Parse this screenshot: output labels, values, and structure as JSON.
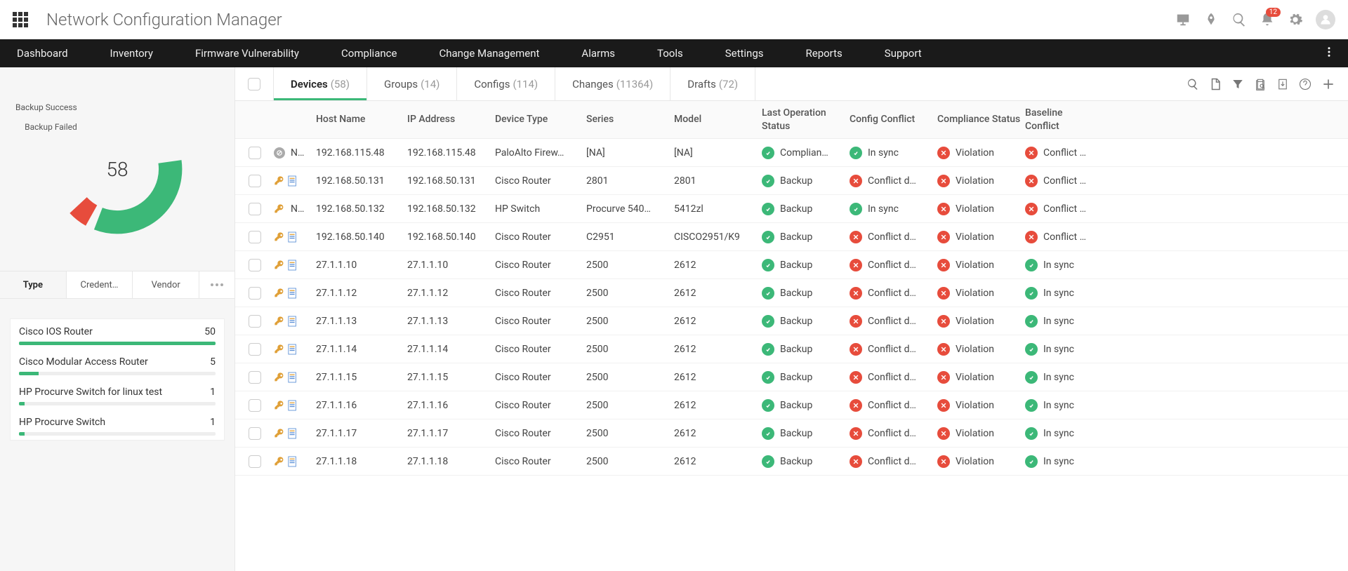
{
  "header": {
    "title": "Network Configuration Manager",
    "notif_badge": "12"
  },
  "nav": {
    "items": [
      "Dashboard",
      "Inventory",
      "Firmware Vulnerability",
      "Compliance",
      "Change Management",
      "Alarms",
      "Tools",
      "Settings",
      "Reports",
      "Support"
    ]
  },
  "chart_data": {
    "type": "pie",
    "title": "",
    "categories": [
      "Backup Success",
      "Backup Failed"
    ],
    "values": [
      55,
      3
    ],
    "center_label": "58",
    "colors": [
      "#3cb878",
      "#e74c3c"
    ]
  },
  "donut": {
    "legend_success": "Backup Success",
    "legend_failed": "Backup Failed",
    "center": "58"
  },
  "filter_tabs": {
    "items": [
      "Type",
      "Credent…",
      "Vendor"
    ],
    "active": 0
  },
  "type_list": [
    {
      "label": "Cisco IOS Router",
      "count": "50",
      "pct": 100
    },
    {
      "label": "Cisco Modular Access Router",
      "count": "5",
      "pct": 10
    },
    {
      "label": "HP Procurve Switch for linux test",
      "count": "1",
      "pct": 3
    },
    {
      "label": "HP Procurve Switch",
      "count": "1",
      "pct": 3
    }
  ],
  "content_tabs": [
    {
      "label": "Devices",
      "count": "(58)",
      "active": true
    },
    {
      "label": "Groups",
      "count": "(14)"
    },
    {
      "label": "Configs",
      "count": "(114)"
    },
    {
      "label": "Changes",
      "count": "(11364)"
    },
    {
      "label": "Drafts",
      "count": "(72)"
    }
  ],
  "columns": {
    "host": "Host Name",
    "ip": "IP Address",
    "type": "Device Type",
    "series": "Series",
    "model": "Model",
    "last_op": "Last Operation Status",
    "conflict": "Config Conflict",
    "compliance": "Compliance Status",
    "baseline": "Baseline Conflict"
  },
  "rows": [
    {
      "icons": "grey",
      "host": "N…",
      "ip": "192.168.115.48",
      "ip2": "192.168.115.48",
      "type": "PaloAlto Firew…",
      "series": "[NA]",
      "model": "[NA]",
      "last": {
        "s": "green",
        "t": "Complian…"
      },
      "conf": {
        "s": "green",
        "t": "In sync"
      },
      "comp": {
        "s": "red",
        "t": "Violation"
      },
      "base": {
        "s": "red",
        "t": "Conflict …"
      }
    },
    {
      "icons": "keydoc",
      "host": "",
      "ip": "192.168.50.131",
      "ip2": "192.168.50.131",
      "type": "Cisco Router",
      "series": "2801",
      "model": "2801",
      "last": {
        "s": "green",
        "t": "Backup"
      },
      "conf": {
        "s": "red",
        "t": "Conflict d…"
      },
      "comp": {
        "s": "red",
        "t": "Violation"
      },
      "base": {
        "s": "red",
        "t": "Conflict …"
      }
    },
    {
      "icons": "key",
      "host": "N…",
      "ip": "192.168.50.132",
      "ip2": "192.168.50.132",
      "type": "HP Switch",
      "series": "Procurve 540…",
      "model": "5412zl",
      "last": {
        "s": "green",
        "t": "Backup"
      },
      "conf": {
        "s": "green",
        "t": "In sync"
      },
      "comp": {
        "s": "red",
        "t": "Violation"
      },
      "base": {
        "s": "red",
        "t": "Conflict …"
      }
    },
    {
      "icons": "keydoc",
      "host": "",
      "ip": "192.168.50.140",
      "ip2": "192.168.50.140",
      "type": "Cisco Router",
      "series": "C2951",
      "model": "CISCO2951/K9",
      "last": {
        "s": "green",
        "t": "Backup"
      },
      "conf": {
        "s": "red",
        "t": "Conflict d…"
      },
      "comp": {
        "s": "red",
        "t": "Violation"
      },
      "base": {
        "s": "red",
        "t": "Conflict …"
      }
    },
    {
      "icons": "keydoc",
      "host": "",
      "ip": "27.1.1.10",
      "ip2": "27.1.1.10",
      "type": "Cisco Router",
      "series": "2500",
      "model": "2612",
      "last": {
        "s": "green",
        "t": "Backup"
      },
      "conf": {
        "s": "red",
        "t": "Conflict d…"
      },
      "comp": {
        "s": "red",
        "t": "Violation"
      },
      "base": {
        "s": "green",
        "t": "In sync"
      }
    },
    {
      "icons": "keydoc",
      "host": "",
      "ip": "27.1.1.12",
      "ip2": "27.1.1.12",
      "type": "Cisco Router",
      "series": "2500",
      "model": "2612",
      "last": {
        "s": "green",
        "t": "Backup"
      },
      "conf": {
        "s": "red",
        "t": "Conflict d…"
      },
      "comp": {
        "s": "red",
        "t": "Violation"
      },
      "base": {
        "s": "green",
        "t": "In sync"
      }
    },
    {
      "icons": "keydoc",
      "host": "",
      "ip": "27.1.1.13",
      "ip2": "27.1.1.13",
      "type": "Cisco Router",
      "series": "2500",
      "model": "2612",
      "last": {
        "s": "green",
        "t": "Backup"
      },
      "conf": {
        "s": "red",
        "t": "Conflict d…"
      },
      "comp": {
        "s": "red",
        "t": "Violation"
      },
      "base": {
        "s": "green",
        "t": "In sync"
      }
    },
    {
      "icons": "keydoc",
      "host": "",
      "ip": "27.1.1.14",
      "ip2": "27.1.1.14",
      "type": "Cisco Router",
      "series": "2500",
      "model": "2612",
      "last": {
        "s": "green",
        "t": "Backup"
      },
      "conf": {
        "s": "red",
        "t": "Conflict d…"
      },
      "comp": {
        "s": "red",
        "t": "Violation"
      },
      "base": {
        "s": "green",
        "t": "In sync"
      }
    },
    {
      "icons": "keydoc",
      "host": "",
      "ip": "27.1.1.15",
      "ip2": "27.1.1.15",
      "type": "Cisco Router",
      "series": "2500",
      "model": "2612",
      "last": {
        "s": "green",
        "t": "Backup"
      },
      "conf": {
        "s": "red",
        "t": "Conflict d…"
      },
      "comp": {
        "s": "red",
        "t": "Violation"
      },
      "base": {
        "s": "green",
        "t": "In sync"
      }
    },
    {
      "icons": "keydoc",
      "host": "",
      "ip": "27.1.1.16",
      "ip2": "27.1.1.16",
      "type": "Cisco Router",
      "series": "2500",
      "model": "2612",
      "last": {
        "s": "green",
        "t": "Backup"
      },
      "conf": {
        "s": "red",
        "t": "Conflict d…"
      },
      "comp": {
        "s": "red",
        "t": "Violation"
      },
      "base": {
        "s": "green",
        "t": "In sync"
      }
    },
    {
      "icons": "keydoc",
      "host": "",
      "ip": "27.1.1.17",
      "ip2": "27.1.1.17",
      "type": "Cisco Router",
      "series": "2500",
      "model": "2612",
      "last": {
        "s": "green",
        "t": "Backup"
      },
      "conf": {
        "s": "red",
        "t": "Conflict d…"
      },
      "comp": {
        "s": "red",
        "t": "Violation"
      },
      "base": {
        "s": "green",
        "t": "In sync"
      }
    },
    {
      "icons": "keydoc",
      "host": "",
      "ip": "27.1.1.18",
      "ip2": "27.1.1.18",
      "type": "Cisco Router",
      "series": "2500",
      "model": "2612",
      "last": {
        "s": "green",
        "t": "Backup"
      },
      "conf": {
        "s": "red",
        "t": "Conflict d…"
      },
      "comp": {
        "s": "red",
        "t": "Violation"
      },
      "base": {
        "s": "green",
        "t": "In sync"
      }
    }
  ]
}
